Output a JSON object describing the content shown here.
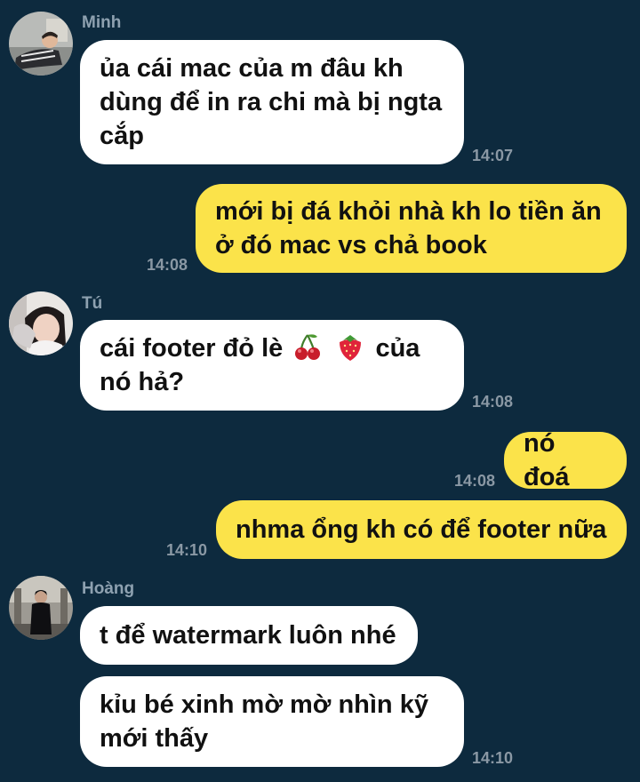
{
  "colors": {
    "background": "#0d2a3e",
    "incoming_bubble": "#ffffff",
    "outgoing_bubble": "#fbe34a",
    "timestamp": "#8a98a4",
    "sender_name": "#8ea1b0"
  },
  "messages": [
    {
      "sender": "Minh",
      "direction": "incoming",
      "text": "ủa cái mac của m đâu kh dùng để in ra chi mà bị ngta cắp",
      "time": "14:07",
      "avatar": "avatar-minh"
    },
    {
      "direction": "outgoing",
      "text": "mới bị đá khỏi nhà kh lo tiền ăn ở đó mac vs chả book",
      "time": "14:08"
    },
    {
      "sender": "Tú",
      "direction": "incoming",
      "text_before": "cái footer đỏ lè",
      "emojis": [
        "cherry-emoji",
        "strawberry-emoji"
      ],
      "text_after": "của nó hả?",
      "time": "14:08",
      "avatar": "avatar-tu"
    },
    {
      "direction": "outgoing",
      "text": "nó đoá",
      "time": "14:08"
    },
    {
      "direction": "outgoing",
      "text": "nhma ổng kh có để footer nữa",
      "time": "14:10"
    },
    {
      "sender": "Hoàng",
      "direction": "incoming",
      "text": "t để watermark luôn nhé",
      "avatar": "avatar-hoang"
    },
    {
      "direction": "incoming",
      "text": "kỉu bé xinh mờ mờ nhìn kỹ mới thấy",
      "time": "14:10"
    }
  ]
}
